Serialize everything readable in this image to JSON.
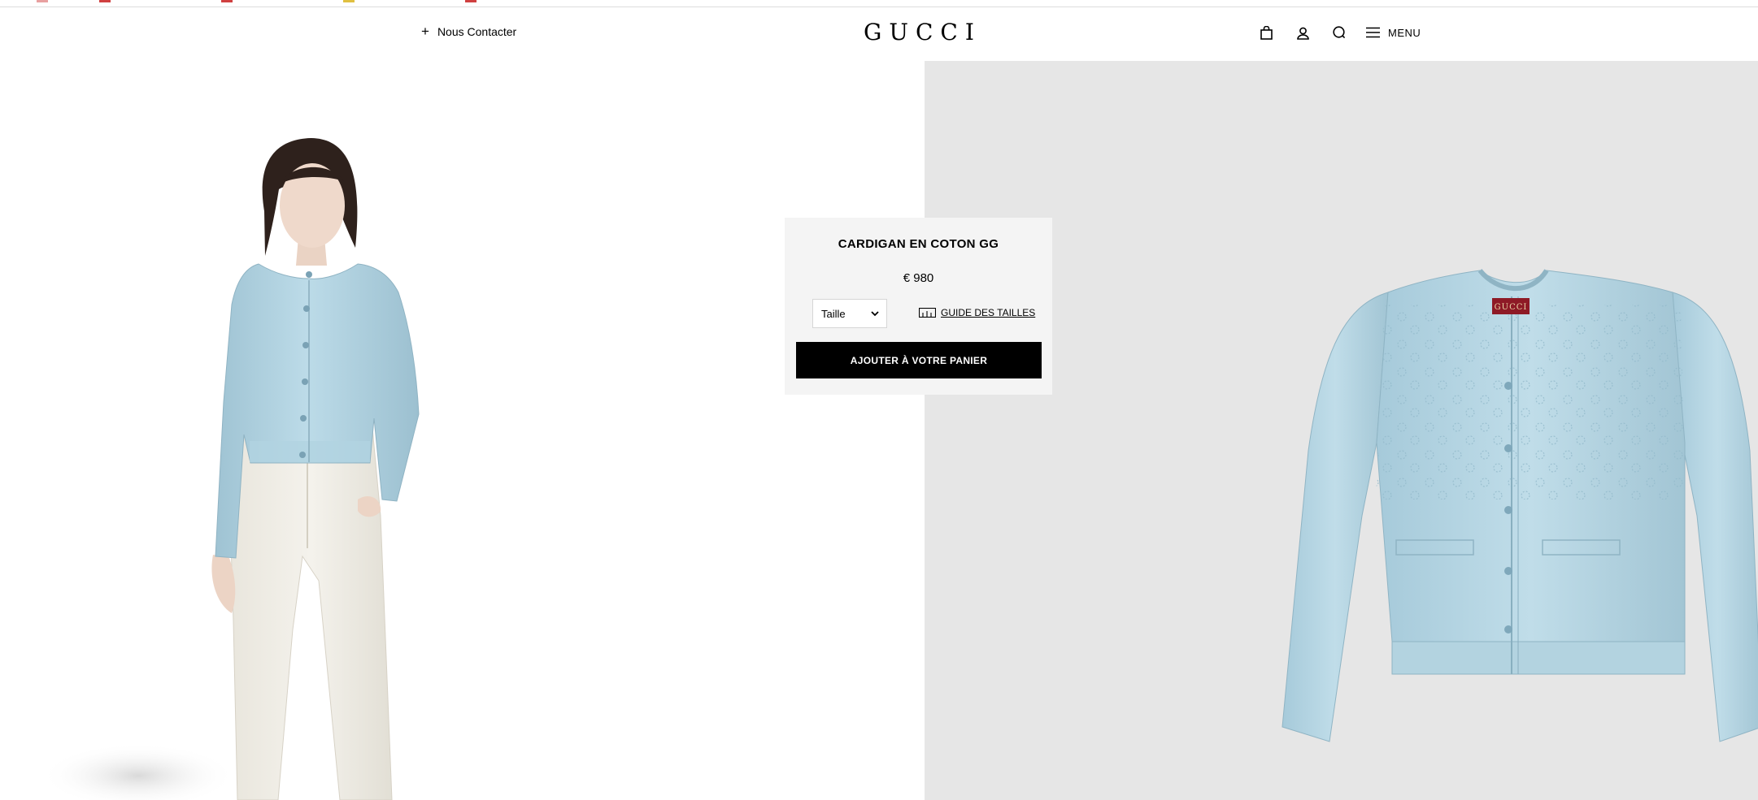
{
  "header": {
    "contact_label": "Nous Contacter",
    "logo_text": "GUCCI",
    "menu_label": "MENU",
    "icons": [
      "shopping-bag-icon",
      "account-icon",
      "search-icon",
      "menu-icon"
    ]
  },
  "product": {
    "title": "CARDIGAN EN COTON GG",
    "price": "€ 980",
    "size_placeholder": "Taille",
    "size_guide_label": "GUIDE DES TAILLES",
    "add_to_cart_label": "AJOUTER À VOTRE PANIER",
    "garment_label": "GUCCI"
  },
  "colors": {
    "garment": "#b9d9e6",
    "panel_bg": "#e6e6e6",
    "button_bg": "#000000"
  }
}
